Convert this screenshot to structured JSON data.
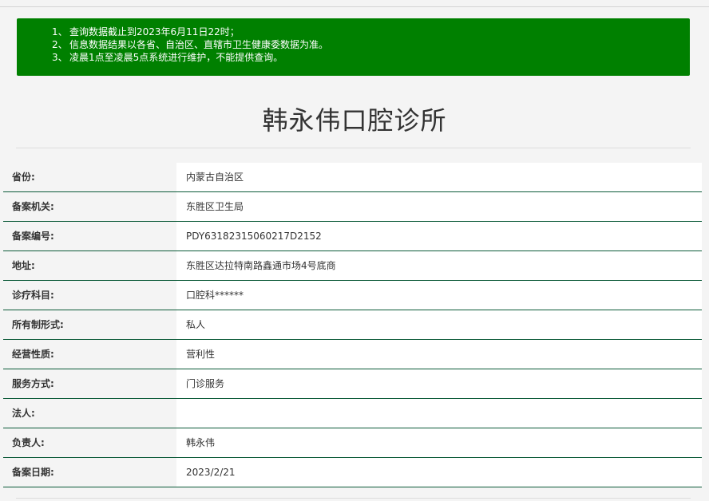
{
  "notice": {
    "items": [
      {
        "num": "1、",
        "text": "查询数据截止到2023年6月11日22时；"
      },
      {
        "num": "2、",
        "text": "信息数据结果以各省、自治区、直辖市卫生健康委数据为准。"
      },
      {
        "num": "3、",
        "text": "凌晨1点至凌晨5点系统进行维护，不能提供查询。"
      }
    ],
    "background_color": "#008000",
    "text_color": "#ffffff"
  },
  "page_title": "韩永伟口腔诊所",
  "fields": [
    {
      "label": "省份:",
      "value": "内蒙古自治区"
    },
    {
      "label": "备案机关:",
      "value": "东胜区卫生局"
    },
    {
      "label": "备案编号:",
      "value": "PDY63182315060217D2152"
    },
    {
      "label": "地址:",
      "value": "东胜区达拉特南路鑫通市场4号底商"
    },
    {
      "label": "诊疗科目:",
      "value": "口腔科******"
    },
    {
      "label": "所有制形式:",
      "value": "私人"
    },
    {
      "label": "经营性质:",
      "value": "营利性"
    },
    {
      "label": "服务方式:",
      "value": "门诊服务"
    },
    {
      "label": "法人:",
      "value": ""
    },
    {
      "label": "负责人:",
      "value": "韩永伟"
    },
    {
      "label": "备案日期:",
      "value": "2023/2/21"
    }
  ],
  "colors": {
    "row_divider": "#0b5a38",
    "page_background": "#f4f4f4",
    "value_background": "#ffffff"
  }
}
